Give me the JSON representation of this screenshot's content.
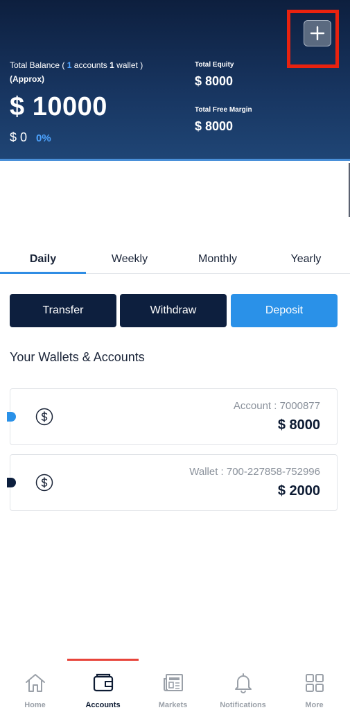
{
  "header": {
    "total_balance_prefix": "Total Balance (",
    "accounts_count": "1",
    "accounts_word": "accounts",
    "wallet_count": "1",
    "wallet_word": "wallet",
    "closing_paren": ")",
    "approx": "(Approx)",
    "total_balance": "$ 10000",
    "change_value": "$ 0",
    "change_percent": "0%",
    "total_equity_label": "Total Equity",
    "total_equity": "$ 8000",
    "free_margin_label": "Total Free Margin",
    "free_margin": "$ 8000",
    "add_icon": "plus-icon",
    "highlight_color": "#e8220f"
  },
  "tabs": [
    "Daily",
    "Weekly",
    "Monthly",
    "Yearly"
  ],
  "active_tab": "Daily",
  "actions": {
    "transfer": "Transfer",
    "withdraw": "Withdraw",
    "deposit": "Deposit"
  },
  "section_title": "Your Wallets & Accounts",
  "items": [
    {
      "subtitle": "Account : 7000877",
      "amount": "$ 8000",
      "icon": "dollar-circle-icon",
      "dot_color": "#2a91e8"
    },
    {
      "subtitle": "Wallet : 700-227858-752996",
      "amount": "$ 2000",
      "icon": "dollar-circle-icon",
      "dot_color": "#0d1f3e"
    }
  ],
  "nav": [
    {
      "label": "Home",
      "icon": "home-icon"
    },
    {
      "label": "Accounts",
      "icon": "wallet-icon"
    },
    {
      "label": "Markets",
      "icon": "newspaper-icon"
    },
    {
      "label": "Notifications",
      "icon": "bell-icon"
    },
    {
      "label": "More",
      "icon": "grid-icon"
    }
  ],
  "active_nav": "Accounts",
  "colors": {
    "navy": "#0d1f3e",
    "accent_blue": "#2a91e8",
    "nav_indicator": "#e8443a"
  }
}
